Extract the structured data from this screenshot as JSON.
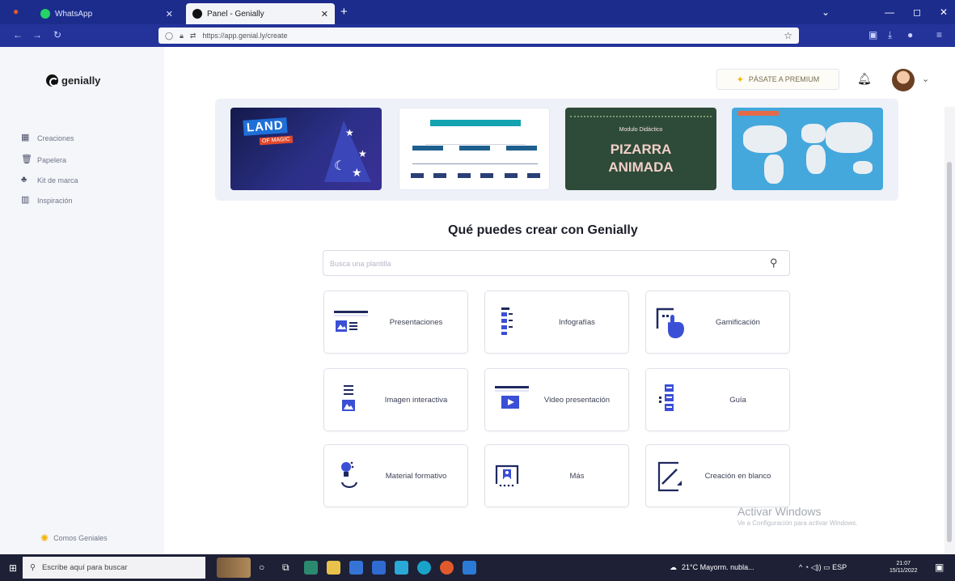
{
  "browser": {
    "tabs": [
      {
        "label": "WhatsApp",
        "favicon_color": "#25d366"
      },
      {
        "label": "Panel - Genially",
        "favicon_color": "#111111"
      }
    ],
    "url": "https://app.genial.ly/create",
    "icons": [
      "back-icon",
      "forward-icon",
      "reload-icon",
      "shield-icon",
      "lock-icon",
      "bookmark-star-icon"
    ]
  },
  "sidebar": {
    "logo_text": "genially",
    "items": [
      {
        "label": "Creaciones",
        "icon": "grid-icon"
      },
      {
        "label": "Papelera",
        "icon": "trash-icon"
      },
      {
        "label": "Kit de marca",
        "icon": "brand-kit-icon"
      },
      {
        "label": "Inspiración",
        "icon": "inspiration-icon"
      }
    ],
    "footer": "Comos Geniales"
  },
  "header": {
    "premium_label": "PÁSATE A PREMIUM"
  },
  "banner": {
    "thumbs": [
      {
        "line1": "LAND",
        "line2": "OF MAGIC"
      },
      {
        "line1": ""
      },
      {
        "line1": "Modulo Didáctico",
        "line2": "PIZARRA",
        "line3": "ANIMADA"
      },
      {
        "line1": ""
      }
    ]
  },
  "main": {
    "title": "Qué puedes crear con Genially",
    "search_placeholder": "Busca una plantilla",
    "cards": [
      {
        "label": "Presentaciones",
        "icon": "presentation-icon"
      },
      {
        "label": "Infografías",
        "icon": "infographic-icon"
      },
      {
        "label": "Gamificación",
        "icon": "gamification-icon"
      },
      {
        "label": "Imagen interactiva",
        "icon": "interactive-image-icon"
      },
      {
        "label": "Video presentación",
        "icon": "video-presentation-icon"
      },
      {
        "label": "Guía",
        "icon": "guide-icon"
      },
      {
        "label": "Material formativo",
        "icon": "training-material-icon"
      },
      {
        "label": "Más",
        "icon": "more-icon"
      },
      {
        "label": "Creación en blanco",
        "icon": "blank-creation-icon"
      }
    ]
  },
  "watermark": {
    "line1": "Activar Windows",
    "line2": "Ve a Configuración para activar Windows."
  },
  "taskbar": {
    "search_placeholder": "Escribe aquí para buscar",
    "weather": "21°C Mayorm. nubla...",
    "lang": "ESP",
    "time": "21:07",
    "date": "15/11/2022"
  },
  "colors": {
    "tabbar": "#1c2c8c",
    "accent_blue": "#3b4fd6",
    "accent_dark": "#1f2960"
  }
}
